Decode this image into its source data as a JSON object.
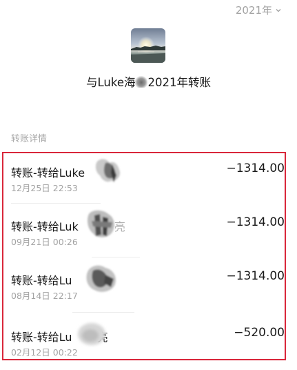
{
  "header": {
    "year_label": "2021年",
    "title_prefix": "与Luke海",
    "title_suffix": "2021年转账"
  },
  "section": {
    "label": "转账详情"
  },
  "transactions": [
    {
      "name": "转账-转给Luke",
      "date": "12月25日 22:53",
      "amount": "−1314.00"
    },
    {
      "name": "转账-转给Luk",
      "name_tail": "亮",
      "date": "09月21日 00:26",
      "amount": "−1314.00"
    },
    {
      "name": "转账-转给Lu",
      "date": "08月14日 22:17",
      "amount": "−1314.00"
    },
    {
      "name": "转账-转给Lu",
      "name_tail": "亮",
      "date": "02月12日 00:22",
      "amount": "−520.00"
    }
  ],
  "colors": {
    "highlight_border": "#d9263a",
    "secondary_text": "#a3a3a3"
  },
  "icons": {
    "year_dropdown": "chevron-down-icon",
    "avatar": "sunset-lake-photo"
  }
}
